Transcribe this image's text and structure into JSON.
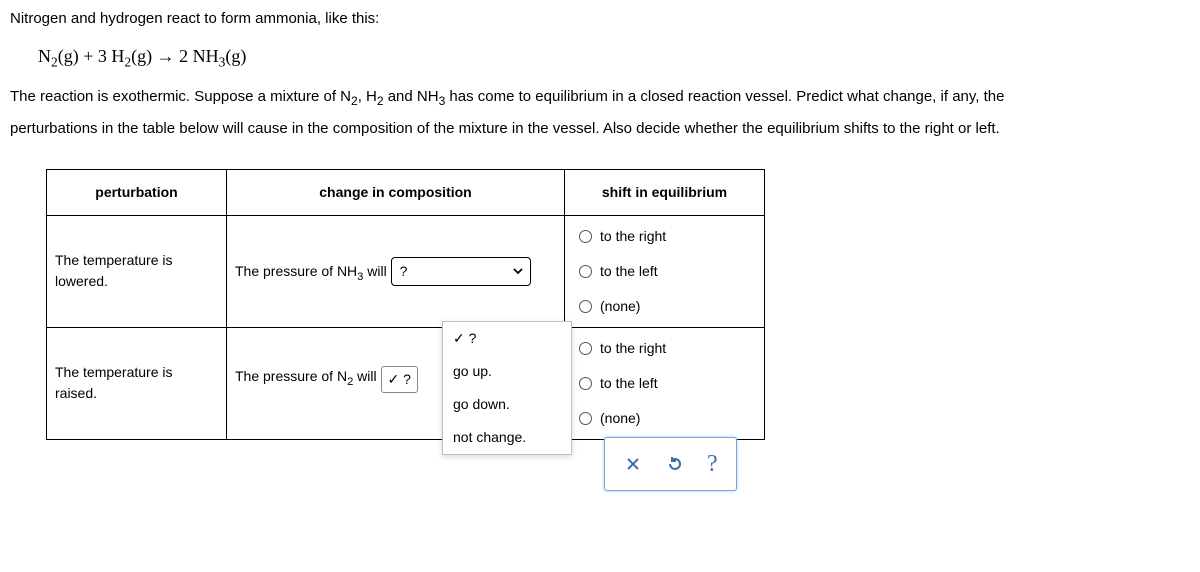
{
  "intro": "Nitrogen and hydrogen react to form ammonia, like this:",
  "equation_html": "N<sub>2</sub>(g) + 3 H<sub>2</sub>(g) → 2 NH<sub>3</sub>(g)",
  "desc_line1_html": "The reaction is exothermic. Suppose a mixture of N<sub>2</sub>, H<sub>2</sub> and NH<sub>3</sub> has come to equilibrium in a closed reaction vessel. Predict what change, if any, the",
  "desc_line2": "perturbations in the table below will cause in the composition of the mixture in the vessel. Also decide whether the equilibrium shifts to the right or left.",
  "headers": {
    "col1": "perturbation",
    "col2": "change in composition",
    "col3": "shift in equilibrium"
  },
  "rows": [
    {
      "perturbation": "The temperature is lowered.",
      "change_prefix_html": "The pressure of NH<sub>3</sub> will",
      "select_value": "?",
      "radios": [
        "to the right",
        "to the left",
        "(none)"
      ]
    },
    {
      "perturbation": "The temperature is raised.",
      "change_prefix_html": "The pressure of N<sub>2</sub> will",
      "select_value": "?",
      "radios": [
        "to the right",
        "to the left",
        "(none)"
      ]
    }
  ],
  "dropdown_options": [
    "?",
    "go up.",
    "go down.",
    "not change."
  ],
  "dropdown_selected": "?",
  "action_icons": {
    "close": "close-icon",
    "reset": "reset-icon",
    "help": "?"
  }
}
